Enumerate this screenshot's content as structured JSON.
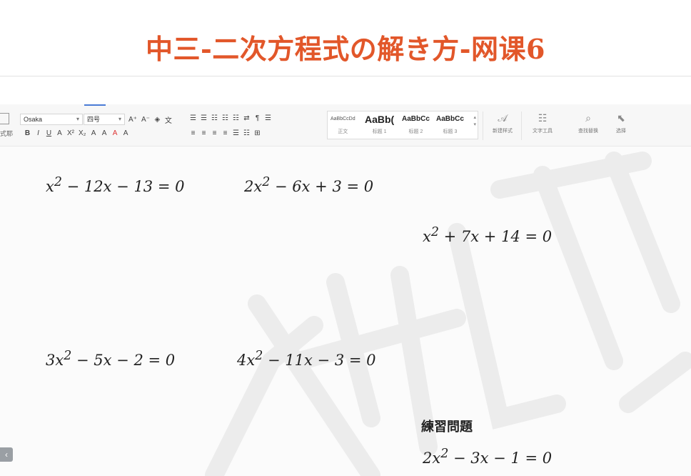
{
  "header": {
    "title": "中三-二次方程式の解き方-网课6"
  },
  "toolbar": {
    "left_label": "式耶",
    "font_family": "Osaka",
    "font_size": "四号",
    "row1_icons": [
      "A⁺",
      "A⁻",
      "◈",
      "文"
    ],
    "row2_icons": [
      "B",
      "I",
      "U",
      "A",
      "X²",
      "X₂",
      "A",
      "A",
      "A",
      "A"
    ],
    "row3_icons": [
      "☰",
      "☰",
      "☷",
      "☷",
      "☷",
      "⇄",
      "¶",
      "☰"
    ],
    "row4_icons": [
      "≡",
      "≡",
      "≡",
      "≡",
      "☰",
      "☷",
      "⊞"
    ],
    "styles": [
      {
        "sample": "AaBbCcDd",
        "label": "正文"
      },
      {
        "sample": "AaBb(",
        "label": "标题 1"
      },
      {
        "sample": "AaBbCc",
        "label": "标题 2"
      },
      {
        "sample": "AaBbCc",
        "label": "标题 3"
      }
    ],
    "new_style_label": "新建样式",
    "text_tools_label": "文字工具",
    "find_replace_label": "查找替换",
    "select_label": "选择"
  },
  "document": {
    "equations": [
      {
        "lead": "x",
        "exp": "2",
        "rest": " − 12x − 13 = 0"
      },
      {
        "lead": "2x",
        "exp": "2",
        "rest": " − 6x + 3 = 0"
      },
      {
        "lead": "x",
        "exp": "2",
        "rest": " + 7x + 14 = 0"
      },
      {
        "lead": "3x",
        "exp": "2",
        "rest": " − 5x − 2 = 0"
      },
      {
        "lead": "4x",
        "exp": "2",
        "rest": " − 11x − 3 = 0"
      },
      {
        "lead": "2x",
        "exp": "2",
        "rest": " − 3x − 1 = 0"
      }
    ],
    "practice_title": "練習問題",
    "prev_button": "‹"
  }
}
